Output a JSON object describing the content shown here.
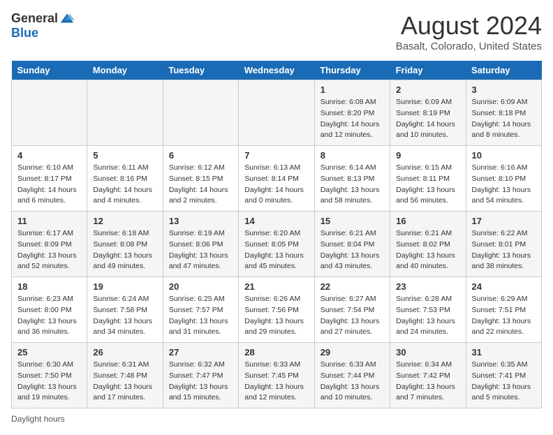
{
  "logo": {
    "general": "General",
    "blue": "Blue"
  },
  "title": {
    "month_year": "August 2024",
    "location": "Basalt, Colorado, United States"
  },
  "days_of_week": [
    "Sunday",
    "Monday",
    "Tuesday",
    "Wednesday",
    "Thursday",
    "Friday",
    "Saturday"
  ],
  "weeks": [
    [
      {
        "day": "",
        "info": ""
      },
      {
        "day": "",
        "info": ""
      },
      {
        "day": "",
        "info": ""
      },
      {
        "day": "",
        "info": ""
      },
      {
        "day": "1",
        "info": "Sunrise: 6:08 AM\nSunset: 8:20 PM\nDaylight: 14 hours\nand 12 minutes."
      },
      {
        "day": "2",
        "info": "Sunrise: 6:09 AM\nSunset: 8:19 PM\nDaylight: 14 hours\nand 10 minutes."
      },
      {
        "day": "3",
        "info": "Sunrise: 6:09 AM\nSunset: 8:18 PM\nDaylight: 14 hours\nand 8 minutes."
      }
    ],
    [
      {
        "day": "4",
        "info": "Sunrise: 6:10 AM\nSunset: 8:17 PM\nDaylight: 14 hours\nand 6 minutes."
      },
      {
        "day": "5",
        "info": "Sunrise: 6:11 AM\nSunset: 8:16 PM\nDaylight: 14 hours\nand 4 minutes."
      },
      {
        "day": "6",
        "info": "Sunrise: 6:12 AM\nSunset: 8:15 PM\nDaylight: 14 hours\nand 2 minutes."
      },
      {
        "day": "7",
        "info": "Sunrise: 6:13 AM\nSunset: 8:14 PM\nDaylight: 14 hours\nand 0 minutes."
      },
      {
        "day": "8",
        "info": "Sunrise: 6:14 AM\nSunset: 8:13 PM\nDaylight: 13 hours\nand 58 minutes."
      },
      {
        "day": "9",
        "info": "Sunrise: 6:15 AM\nSunset: 8:11 PM\nDaylight: 13 hours\nand 56 minutes."
      },
      {
        "day": "10",
        "info": "Sunrise: 6:16 AM\nSunset: 8:10 PM\nDaylight: 13 hours\nand 54 minutes."
      }
    ],
    [
      {
        "day": "11",
        "info": "Sunrise: 6:17 AM\nSunset: 8:09 PM\nDaylight: 13 hours\nand 52 minutes."
      },
      {
        "day": "12",
        "info": "Sunrise: 6:18 AM\nSunset: 8:08 PM\nDaylight: 13 hours\nand 49 minutes."
      },
      {
        "day": "13",
        "info": "Sunrise: 6:19 AM\nSunset: 8:06 PM\nDaylight: 13 hours\nand 47 minutes."
      },
      {
        "day": "14",
        "info": "Sunrise: 6:20 AM\nSunset: 8:05 PM\nDaylight: 13 hours\nand 45 minutes."
      },
      {
        "day": "15",
        "info": "Sunrise: 6:21 AM\nSunset: 8:04 PM\nDaylight: 13 hours\nand 43 minutes."
      },
      {
        "day": "16",
        "info": "Sunrise: 6:21 AM\nSunset: 8:02 PM\nDaylight: 13 hours\nand 40 minutes."
      },
      {
        "day": "17",
        "info": "Sunrise: 6:22 AM\nSunset: 8:01 PM\nDaylight: 13 hours\nand 38 minutes."
      }
    ],
    [
      {
        "day": "18",
        "info": "Sunrise: 6:23 AM\nSunset: 8:00 PM\nDaylight: 13 hours\nand 36 minutes."
      },
      {
        "day": "19",
        "info": "Sunrise: 6:24 AM\nSunset: 7:58 PM\nDaylight: 13 hours\nand 34 minutes."
      },
      {
        "day": "20",
        "info": "Sunrise: 6:25 AM\nSunset: 7:57 PM\nDaylight: 13 hours\nand 31 minutes."
      },
      {
        "day": "21",
        "info": "Sunrise: 6:26 AM\nSunset: 7:56 PM\nDaylight: 13 hours\nand 29 minutes."
      },
      {
        "day": "22",
        "info": "Sunrise: 6:27 AM\nSunset: 7:54 PM\nDaylight: 13 hours\nand 27 minutes."
      },
      {
        "day": "23",
        "info": "Sunrise: 6:28 AM\nSunset: 7:53 PM\nDaylight: 13 hours\nand 24 minutes."
      },
      {
        "day": "24",
        "info": "Sunrise: 6:29 AM\nSunset: 7:51 PM\nDaylight: 13 hours\nand 22 minutes."
      }
    ],
    [
      {
        "day": "25",
        "info": "Sunrise: 6:30 AM\nSunset: 7:50 PM\nDaylight: 13 hours\nand 19 minutes."
      },
      {
        "day": "26",
        "info": "Sunrise: 6:31 AM\nSunset: 7:48 PM\nDaylight: 13 hours\nand 17 minutes."
      },
      {
        "day": "27",
        "info": "Sunrise: 6:32 AM\nSunset: 7:47 PM\nDaylight: 13 hours\nand 15 minutes."
      },
      {
        "day": "28",
        "info": "Sunrise: 6:33 AM\nSunset: 7:45 PM\nDaylight: 13 hours\nand 12 minutes."
      },
      {
        "day": "29",
        "info": "Sunrise: 6:33 AM\nSunset: 7:44 PM\nDaylight: 13 hours\nand 10 minutes."
      },
      {
        "day": "30",
        "info": "Sunrise: 6:34 AM\nSunset: 7:42 PM\nDaylight: 13 hours\nand 7 minutes."
      },
      {
        "day": "31",
        "info": "Sunrise: 6:35 AM\nSunset: 7:41 PM\nDaylight: 13 hours\nand 5 minutes."
      }
    ]
  ],
  "footer": {
    "daylight_label": "Daylight hours"
  }
}
